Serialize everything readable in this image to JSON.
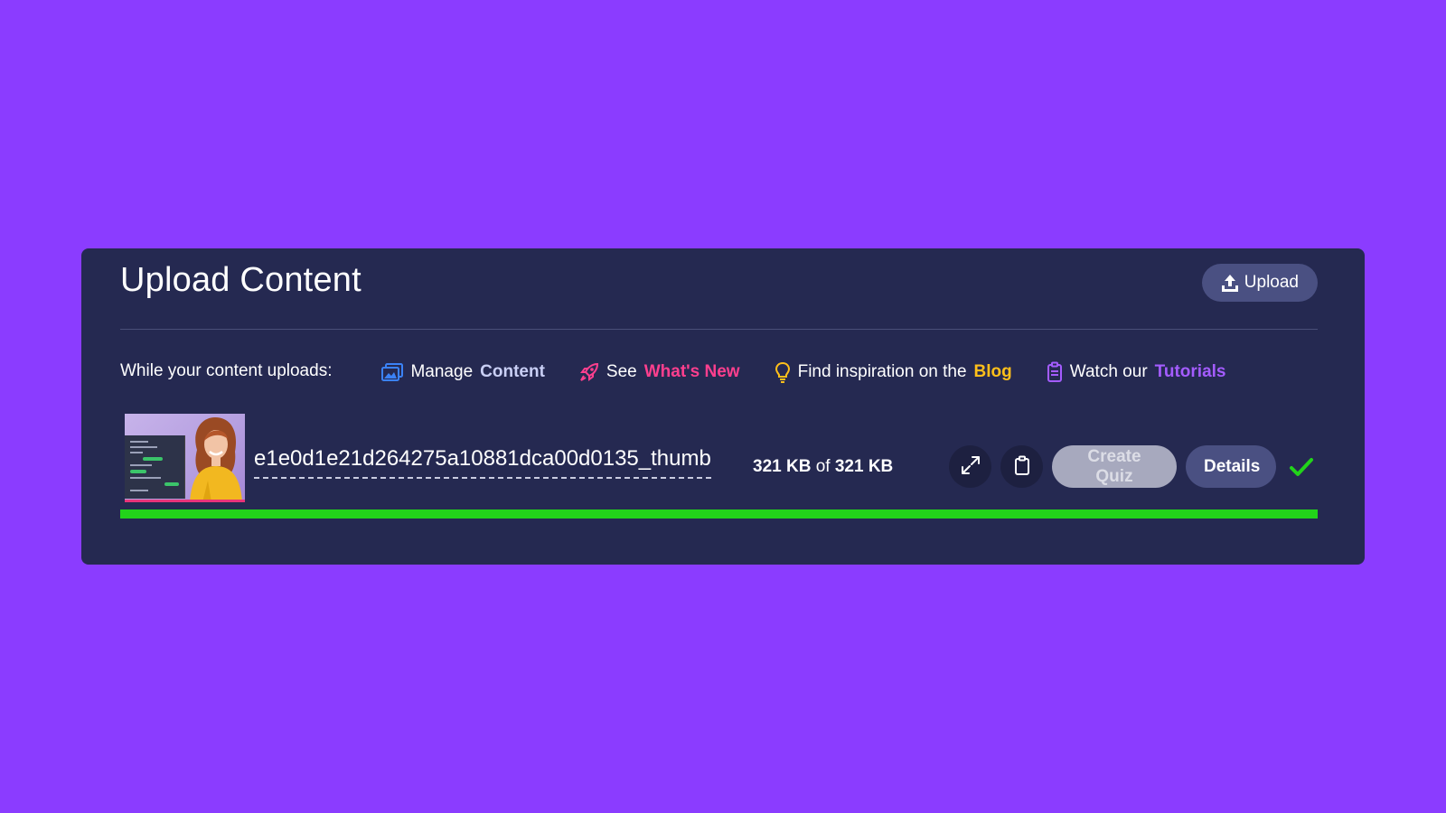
{
  "panel": {
    "title": "Upload Content",
    "upload_button": {
      "label": "Upload",
      "icon": "upload-icon"
    }
  },
  "helpers": {
    "lead": "While your content uploads:",
    "links": [
      {
        "prefix": "Manage",
        "highlight": "Content",
        "icon": "image-icon",
        "color": "#c9cff5"
      },
      {
        "prefix": "See",
        "highlight": "What's New",
        "icon": "rocket-icon",
        "color": "#ff3f8e"
      },
      {
        "prefix": "Find inspiration on the",
        "highlight": "Blog",
        "icon": "lightbulb-icon",
        "color": "#ffbf1a"
      },
      {
        "prefix": "Watch our",
        "highlight": "Tutorials",
        "icon": "clipboard-icon",
        "color": "#a45cff"
      }
    ]
  },
  "file": {
    "name": "e1e0d1e21d264275a10881dca00d0135_thumb",
    "uploaded": "321 KB",
    "of": "of",
    "total": "321 KB",
    "progress": 1.0,
    "actions": {
      "expand_icon": "expand-icon",
      "copy_icon": "clipboard-icon",
      "create_quiz": "Create Quiz",
      "details": "Details",
      "status_icon": "checkmark-icon"
    }
  },
  "colors": {
    "background": "#8b3cff",
    "panel": "#252951",
    "progress": "#22d31a",
    "check": "#22d31a"
  }
}
